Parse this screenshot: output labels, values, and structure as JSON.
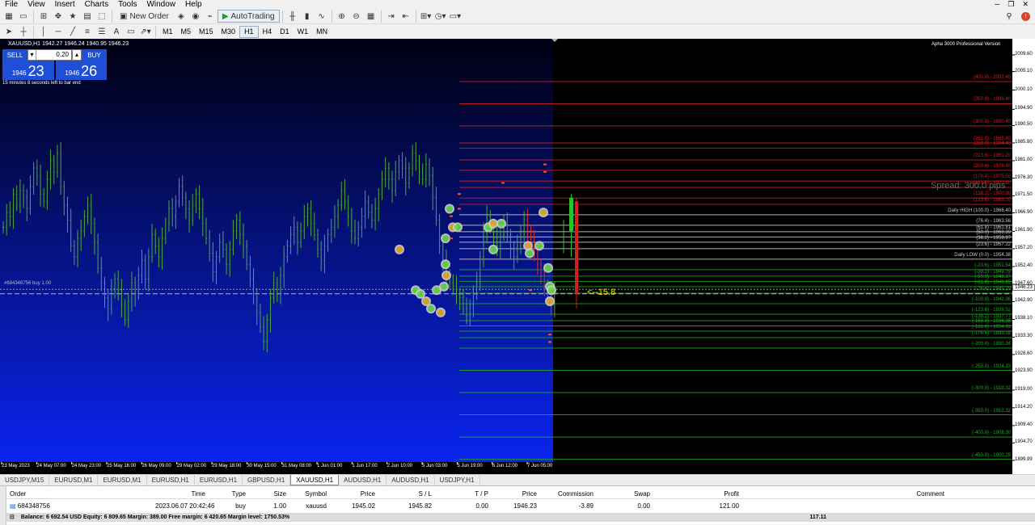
{
  "menu": [
    "File",
    "View",
    "Insert",
    "Charts",
    "Tools",
    "Window",
    "Help"
  ],
  "toolbar": {
    "new_order_label": "New Order",
    "auto_trading_label": "AutoTrading"
  },
  "timeframes": [
    "M1",
    "M5",
    "M15",
    "M30",
    "H1",
    "H4",
    "D1",
    "W1",
    "MN"
  ],
  "active_timeframe": "H1",
  "chart": {
    "title": "XAUUSD,H1",
    "ohlc": "1942.27 1946.24 1940.95 1946.23",
    "brand": "Apha 3000 Professional Version",
    "spread": "Spread: 300.0 pips",
    "countdown": "15 minutes 8 seconds left to bar end",
    "arrow_label": "<--15.8",
    "order_line_label": "#684348756 buy 1.00",
    "current_price_tag": "1946.23",
    "trade_panel": {
      "sell_label": "SELL",
      "buy_label": "BUY",
      "lot": "0.20",
      "sell_small": "1946",
      "sell_big": "23",
      "buy_small": "1946",
      "buy_big": "26"
    },
    "colors": {
      "candle_green": "#4fa83a",
      "level_red": "#d22020",
      "level_green": "#1bb01b",
      "level_white": "#d0d0d0",
      "bg_gradient_top": "#000011",
      "bg_gradient_bottom": "#0b24f0"
    }
  },
  "chart_data": {
    "type": "candlestick",
    "symbol": "XAUUSD",
    "timeframe": "H1",
    "ylim": [
      1899.99,
      2012.0
    ],
    "y_ticks": [
      "2009.60",
      "2005.10",
      "2000.10",
      "1994.90",
      "1990.50",
      "1985.80",
      "1981.00",
      "1976.30",
      "1971.50",
      "1966.90",
      "1961.90",
      "1957.20",
      "1952.40",
      "1947.60",
      "1942.90",
      "1938.10",
      "1933.30",
      "1928.60",
      "1923.90",
      "1919.00",
      "1914.20",
      "1909.40",
      "1904.70",
      "1899.99"
    ],
    "x_ticks": [
      "23 May 2023",
      "24 May 07:00",
      "24 May 23:00",
      "25 May 16:00",
      "26 May 09:00",
      "29 May 02:00",
      "29 May 18:00",
      "30 May 15:00",
      "31 May 08:00",
      "1 Jun 01:00",
      "1 Jun 17:00",
      "2 Jun 10:00",
      "5 Jun 03:00",
      "5 Jun 19:00",
      "6 Jun 12:00",
      "7 Jun 05:00"
    ],
    "levels": [
      {
        "label": "(400.0) - 2002.40",
        "value": 2002.4,
        "color": "red"
      },
      {
        "label": "(350.0) - 1996.40",
        "value": 1996.4,
        "color": "red"
      },
      {
        "label": "(300.0) - 1990.40",
        "value": 1990.4,
        "color": "red"
      },
      {
        "label": "(261.8) - 1985.80",
        "value": 1985.8,
        "color": "red"
      },
      {
        "label": "(250.0) - 1984.40",
        "value": 1984.4,
        "color": "red"
      },
      {
        "label": "(223.6) - 1981.20",
        "value": 1981.2,
        "color": "red"
      },
      {
        "label": "(200.0) - 1978.40",
        "value": 1978.4,
        "color": "red"
      },
      {
        "label": "(176.4) - 1975.50",
        "value": 1975.5,
        "color": "red"
      },
      {
        "label": "(161.8) - 1973.80",
        "value": 1973.8,
        "color": "red"
      },
      {
        "label": "(138.2) - 1970.90",
        "value": 1970.9,
        "color": "red"
      },
      {
        "label": "(123.6) - 1969.20",
        "value": 1969.2,
        "color": "red"
      },
      {
        "label": "Daily HIGH (100.0) - 1966.40",
        "value": 1966.4,
        "color": "white"
      },
      {
        "label": "(76.4) - 1963.56",
        "value": 1963.56,
        "color": "white"
      },
      {
        "label": "(61.8) - 1961.81",
        "value": 1961.81,
        "color": "white"
      },
      {
        "label": "(50.0) - 1960.39",
        "value": 1960.39,
        "color": "white"
      },
      {
        "label": "(38.2) - 1958.97",
        "value": 1958.97,
        "color": "white"
      },
      {
        "label": "(23.6) - 1957.22",
        "value": 1957.22,
        "color": "white"
      },
      {
        "label": "Daily LOW (0.0) - 1954.38",
        "value": 1954.38,
        "color": "white"
      },
      {
        "label": "(-23.6) - 1951.54",
        "value": 1951.54,
        "color": "green"
      },
      {
        "label": "(-38.2) - 1949.79",
        "value": 1949.79,
        "color": "green"
      },
      {
        "label": "(-50.0) - 1948.37",
        "value": 1948.37,
        "color": "green"
      },
      {
        "label": "(-61.8) - 1946.95",
        "value": 1946.95,
        "color": "green"
      },
      {
        "label": "(-76.4) - 1945.20",
        "value": 1945.2,
        "color": "green"
      },
      {
        "label": "(-100.0) - 1942.36",
        "value": 1942.36,
        "color": "green"
      },
      {
        "label": "(-123.6) - 1939.52",
        "value": 1939.52,
        "color": "green"
      },
      {
        "label": "(-138.2) - 1937.77",
        "value": 1937.77,
        "color": "green"
      },
      {
        "label": "(-150.0) - 1936.35",
        "value": 1936.35,
        "color": "green"
      },
      {
        "label": "(-161.8) - 1934.93",
        "value": 1934.93,
        "color": "green"
      },
      {
        "label": "(-176.4) - 1933.18",
        "value": 1933.18,
        "color": "green"
      },
      {
        "label": "(-200.0) - 1930.34",
        "value": 1930.34,
        "color": "green"
      },
      {
        "label": "(-250.0) - 1924.33",
        "value": 1924.33,
        "color": "green"
      },
      {
        "label": "(-300.0) - 1918.32",
        "value": 1918.32,
        "color": "green"
      },
      {
        "label": "(-350.0) - 1912.32",
        "value": 1912.32,
        "color": "green"
      },
      {
        "label": "(-400.0) - 1906.30",
        "value": 1906.3,
        "color": "green"
      },
      {
        "label": "(-450.0) - 1900.29",
        "value": 1900.29,
        "color": "green"
      }
    ],
    "order_price": 1945.02,
    "current_price": 1946.23,
    "closes": [
      1963,
      1967,
      1966,
      1972,
      1969,
      1973,
      1971,
      1968,
      1974,
      1979,
      1977,
      1972,
      1970,
      1976,
      1981,
      1978,
      1983,
      1974,
      1969,
      1965,
      1958,
      1955,
      1960,
      1962,
      1966,
      1969,
      1964,
      1959,
      1952,
      1948,
      1944,
      1941,
      1946,
      1949,
      1946,
      1942,
      1938,
      1943,
      1948,
      1945,
      1950,
      1954,
      1949,
      1955,
      1961,
      1958,
      1955,
      1960,
      1964,
      1968,
      1966,
      1970,
      1974,
      1971,
      1968,
      1965,
      1969,
      1972,
      1968,
      1964,
      1960,
      1956,
      1951,
      1955,
      1959,
      1957,
      1953,
      1957,
      1962,
      1965,
      1961,
      1958,
      1953,
      1949,
      1945,
      1940,
      1936,
      1932,
      1938,
      1944,
      1948,
      1945,
      1950,
      1955,
      1958,
      1961,
      1963,
      1959,
      1962,
      1966,
      1968,
      1964,
      1961,
      1957,
      1954,
      1958,
      1961,
      1963,
      1966,
      1969,
      1973,
      1970,
      1966,
      1962,
      1960,
      1963,
      1966,
      1970,
      1967,
      1965,
      1968,
      1972,
      1976,
      1979,
      1976,
      1973,
      1978,
      1981,
      1979,
      1975,
      1979,
      1983,
      1981,
      1978,
      1976,
      1980,
      1977,
      1971,
      1965,
      1958,
      1954,
      1950,
      1948,
      1947,
      1945,
      1944,
      1941,
      1939,
      1942,
      1945,
      1948,
      1955,
      1962,
      1966,
      1963,
      1960,
      1958,
      1961,
      1964,
      1961,
      1957,
      1955,
      1958,
      1962,
      1965,
      1962,
      1960,
      1956,
      1953,
      1951,
      1946,
      1944,
      1942,
      1946
    ]
  },
  "tabs": [
    "USDJPY,M15",
    "EURUSD,M1",
    "EURUSD,M1",
    "EURUSD,H1",
    "EURUSD,H1",
    "GBPUSD,H1",
    "XAUUSD,H1",
    "AUDUSD,H1",
    "AUDUSD,H1",
    "USDJPY,H1"
  ],
  "active_tab_index": 6,
  "terminal": {
    "headers": [
      "Order",
      "Time",
      "Type",
      "Size",
      "Symbol",
      "Price",
      "S / L",
      "T / P",
      "Price",
      "Commission",
      "Swap",
      "Profit",
      "Comment"
    ],
    "row": [
      "684348756",
      "2023.06.07 20:42:46",
      "buy",
      "1.00",
      "xauusd",
      "1945.02",
      "1945.82",
      "0.00",
      "1946.23",
      "-3.89",
      "0.00",
      "121.00",
      ""
    ],
    "balance_line": "Balance: 6 692.54 USD  Equity: 6 809.65  Margin: 389.00  Free margin: 6 420.65  Margin level: 1750.53%",
    "total_profit": "117.11"
  }
}
